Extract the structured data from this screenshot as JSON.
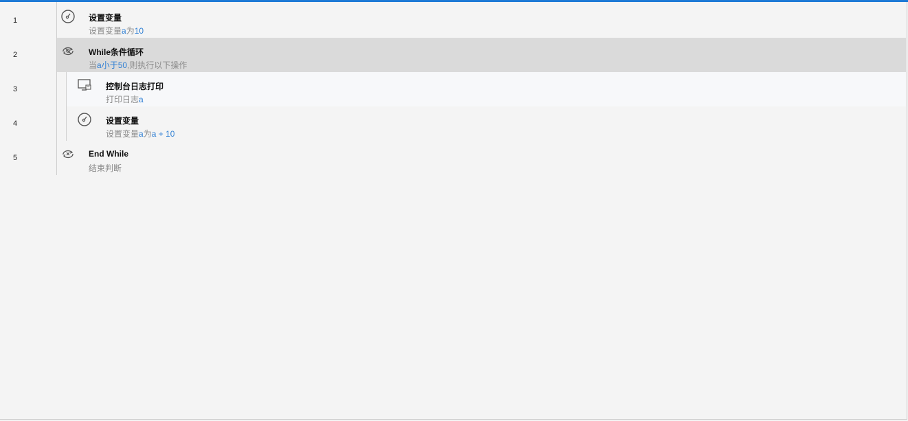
{
  "rows": [
    {
      "num": "1",
      "title": "设置变量",
      "desc": [
        {
          "t": "设置变量",
          "hl": false
        },
        {
          "t": "a",
          "hl": true
        },
        {
          "t": "为",
          "hl": false
        },
        {
          "t": "10",
          "hl": true
        }
      ],
      "icon": "gauge-icon"
    },
    {
      "num": "2",
      "title": "While条件循环",
      "desc": [
        {
          "t": "当",
          "hl": false
        },
        {
          "t": "a",
          "hl": true
        },
        {
          "t": "小于",
          "hl": true
        },
        {
          "t": "50",
          "hl": true
        },
        {
          "t": ",则执行以下操作",
          "hl": false
        }
      ],
      "icon": "loop-icon"
    },
    {
      "num": "3",
      "title": "控制台日志打印",
      "desc": [
        {
          "t": "打印日志",
          "hl": false
        },
        {
          "t": "a",
          "hl": true
        }
      ],
      "icon": "console-icon"
    },
    {
      "num": "4",
      "title": "设置变量",
      "desc": [
        {
          "t": "设置变量",
          "hl": false
        },
        {
          "t": "a",
          "hl": true
        },
        {
          "t": "为",
          "hl": false
        },
        {
          "t": "a + 10",
          "hl": true
        }
      ],
      "icon": "gauge-icon"
    },
    {
      "num": "5",
      "title": "End While",
      "desc": [
        {
          "t": "结束判断",
          "hl": false
        }
      ],
      "icon": "end-loop-icon"
    }
  ],
  "colors": {
    "accent": "#1e7ad6",
    "highlight": "#2f7fd4",
    "selected": "#dadada"
  }
}
